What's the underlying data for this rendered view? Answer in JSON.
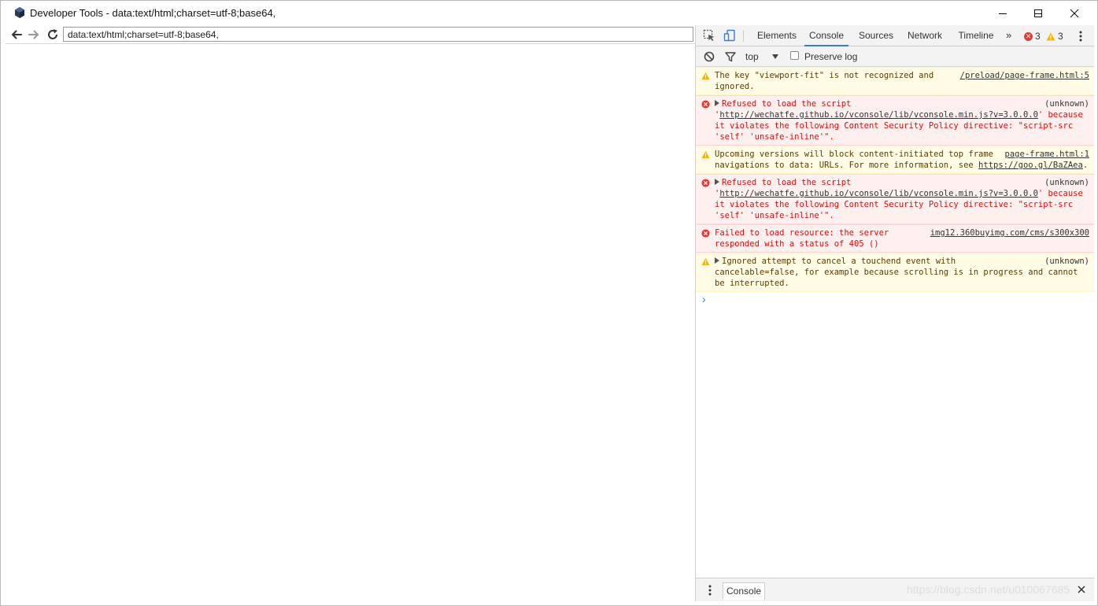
{
  "window": {
    "title": "Developer Tools - data:text/html;charset=utf-8;base64,"
  },
  "browser": {
    "url": "data:text/html;charset=utf-8;base64,"
  },
  "devtools": {
    "tabs": [
      {
        "label": "Elements",
        "active": false
      },
      {
        "label": "Console",
        "active": true
      },
      {
        "label": "Sources",
        "active": false
      },
      {
        "label": "Network",
        "active": false
      },
      {
        "label": "Timeline",
        "active": false
      }
    ],
    "more_tabs": "»",
    "error_count": "3",
    "warning_count": "3",
    "toolbar": {
      "context": "top",
      "preserve_log_label": "Preserve log",
      "preserve_log_checked": false
    },
    "messages": [
      {
        "level": "warning",
        "source": "/preload/page-frame.html:5",
        "text": "The key \"viewport-fit\" is not recognized and ignored."
      },
      {
        "level": "error",
        "source": "(unknown)",
        "expandable": true,
        "prefix": "Refused to load the script '",
        "link": "http://wechatfe.github.io/vconsole/lib/vconsole.min.js?v=3.0.0.0",
        "suffix": "' because it violates the following Content Security Policy directive: \"script-src 'self' 'unsafe-inline'\"."
      },
      {
        "level": "warning",
        "source": "page-frame.html:1",
        "prefix": "Upcoming versions will block content-initiated top frame navigations to data: URLs. For more information, see ",
        "link": "https://goo.gl/BaZAea",
        "suffix": "."
      },
      {
        "level": "error",
        "source": "(unknown)",
        "expandable": true,
        "prefix": "Refused to load the script '",
        "link": "http://wechatfe.github.io/vconsole/lib/vconsole.min.js?v=3.0.0.0",
        "suffix": "' because it violates the following Content Security Policy directive: \"script-src 'self' 'unsafe-inline'\"."
      },
      {
        "level": "error",
        "source": "img12.360buyimg.com/cms/s300x300",
        "text": "Failed to load resource: the server responded with a status of 405 ()"
      },
      {
        "level": "warning",
        "source": "(unknown)",
        "expandable": true,
        "text": "Ignored attempt to cancel a touchend event with cancelable=false, for example because scrolling is in progress and cannot be interrupted."
      }
    ],
    "prompt_symbol": "›",
    "drawer": {
      "tab_label": "Console"
    }
  },
  "watermark": "https://blog.csdn.net/u010067685",
  "colors": {
    "active_tab_underline": "#3879d9",
    "error_bg": "#fff0f0",
    "error_text": "#ff0000",
    "warning_bg": "#fffbe5",
    "warning_icon": "#f4b400"
  }
}
